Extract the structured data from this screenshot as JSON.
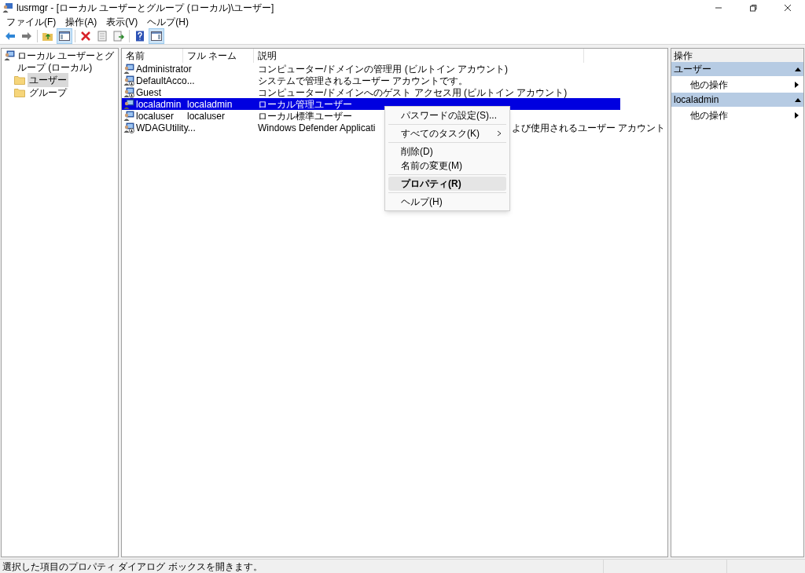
{
  "window": {
    "title": "lusrmgr - [ローカル ユーザーとグループ (ローカル)\\ユーザー]"
  },
  "menu_bar": [
    "ファイル(F)",
    "操作(A)",
    "表示(V)",
    "ヘルプ(H)"
  ],
  "tree": {
    "label": "ローカル ユーザーとグループ (ローカル)",
    "children": [
      {
        "label": "ユーザー",
        "selected": true
      },
      {
        "label": "グループ",
        "selected": false
      }
    ]
  },
  "list": {
    "columns": [
      "名前",
      "フル ネーム",
      "説明"
    ],
    "rows": [
      {
        "name": "Administrator",
        "full_name": "",
        "description": "コンピューター/ドメインの管理用 (ビルトイン アカウント)",
        "disabled": false,
        "selected": false
      },
      {
        "name": "DefaultAcco...",
        "full_name": "",
        "description": "システムで管理されるユーザー アカウントです。",
        "disabled": true,
        "selected": false
      },
      {
        "name": "Guest",
        "full_name": "",
        "description": "コンピューター/ドメインへのゲスト アクセス用 (ビルトイン アカウント)",
        "disabled": true,
        "selected": false
      },
      {
        "name": "localadmin",
        "full_name": "localadmin",
        "description": "ローカル管理ユーザー",
        "disabled": false,
        "selected": true
      },
      {
        "name": "localuser",
        "full_name": "localuser",
        "description": "ローカル標準ユーザー",
        "disabled": false,
        "selected": false
      },
      {
        "name": "WDAGUtility...",
        "full_name": "",
        "description": "Windows Defender Applicati",
        "description_after_menu": "よび使用されるユーザー アカウント",
        "disabled": true,
        "selected": false
      }
    ]
  },
  "context_menu": {
    "groups": [
      [
        {
          "label": "パスワードの設定(S)...",
          "bold": false,
          "has_submenu": false,
          "selected": false
        }
      ],
      [
        {
          "label": "すべてのタスク(K)",
          "bold": false,
          "has_submenu": true,
          "selected": false
        }
      ],
      [
        {
          "label": "削除(D)",
          "bold": false,
          "has_submenu": false,
          "selected": false
        },
        {
          "label": "名前の変更(M)",
          "bold": false,
          "has_submenu": false,
          "selected": false
        }
      ],
      [
        {
          "label": "プロパティ(R)",
          "bold": true,
          "has_submenu": false,
          "selected": true
        }
      ],
      [
        {
          "label": "ヘルプ(H)",
          "bold": false,
          "has_submenu": false,
          "selected": false
        }
      ]
    ]
  },
  "actions": {
    "title": "操作",
    "sections": [
      {
        "title": "ユーザー",
        "expanded": true,
        "items": [
          {
            "label": "他の操作",
            "has_submenu": true
          }
        ]
      },
      {
        "title": "localadmin",
        "expanded": true,
        "items": [
          {
            "label": "他の操作",
            "has_submenu": true
          }
        ]
      }
    ]
  },
  "status_bar": {
    "text": "選択した項目のプロパティ ダイアログ ボックスを開きます。"
  }
}
